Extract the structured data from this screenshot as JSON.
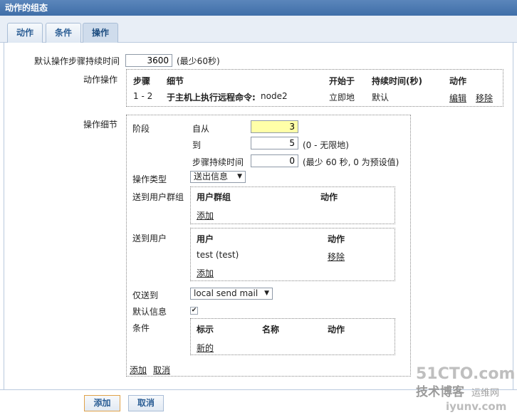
{
  "window": {
    "title": "动作的组态"
  },
  "tabs": [
    {
      "label": "动作"
    },
    {
      "label": "条件"
    },
    {
      "label": "操作"
    }
  ],
  "default_duration": {
    "label": "默认操作步骤持续时间",
    "value": "3600",
    "hint": "(最少60秒)"
  },
  "operations": {
    "label": "动作操作",
    "headers": {
      "steps": "步骤",
      "details": "细节",
      "start": "开始于",
      "duration": "持续时间(秒)",
      "action": "动作"
    },
    "row": {
      "steps": "1 - 2",
      "details": "于主机上执行远程命令:",
      "details_host": "node2",
      "start": "立即地",
      "duration": "默认",
      "edit": "编辑",
      "remove": "移除"
    }
  },
  "details": {
    "label": "操作细节",
    "stage_label": "阶段",
    "from_label": "自从",
    "from_value": "3",
    "to_label": "到",
    "to_value": "5",
    "to_hint": "(0 - 无限地)",
    "step_duration_label": "步骤持续时间",
    "step_duration_value": "0",
    "step_duration_hint": "(最少 60 秒, 0 为预设值)",
    "op_type_label": "操作类型",
    "op_type_value": "送出信息",
    "send_groups_label": "送到用户群组",
    "groups_headers": {
      "group": "用户群组",
      "action": "动作"
    },
    "groups_add": "添加",
    "send_users_label": "送到用户",
    "users_headers": {
      "user": "用户",
      "action": "动作"
    },
    "user_row": {
      "name": "test (test)",
      "remove": "移除"
    },
    "users_add": "添加",
    "only_send_label": "仅送到",
    "only_send_value": "local send mail",
    "default_msg_label": "默认信息",
    "default_msg_checked": "✔",
    "conditions_label": "条件",
    "cond_headers": {
      "tag": "标示",
      "name": "名称",
      "action": "动作"
    },
    "cond_new": "新的",
    "add_link": "添加",
    "cancel_link": "取消"
  },
  "footer": {
    "add_button": "添加",
    "cancel_button": "取消"
  },
  "watermark": {
    "line1": "51CTO.com",
    "line2": "技术博客",
    "line3": "运维网",
    "line4": "iyunv.com"
  },
  "colors": {
    "title_bar": "#4a78b0",
    "highlight_input": "#ffffa8",
    "link": "#222222"
  }
}
